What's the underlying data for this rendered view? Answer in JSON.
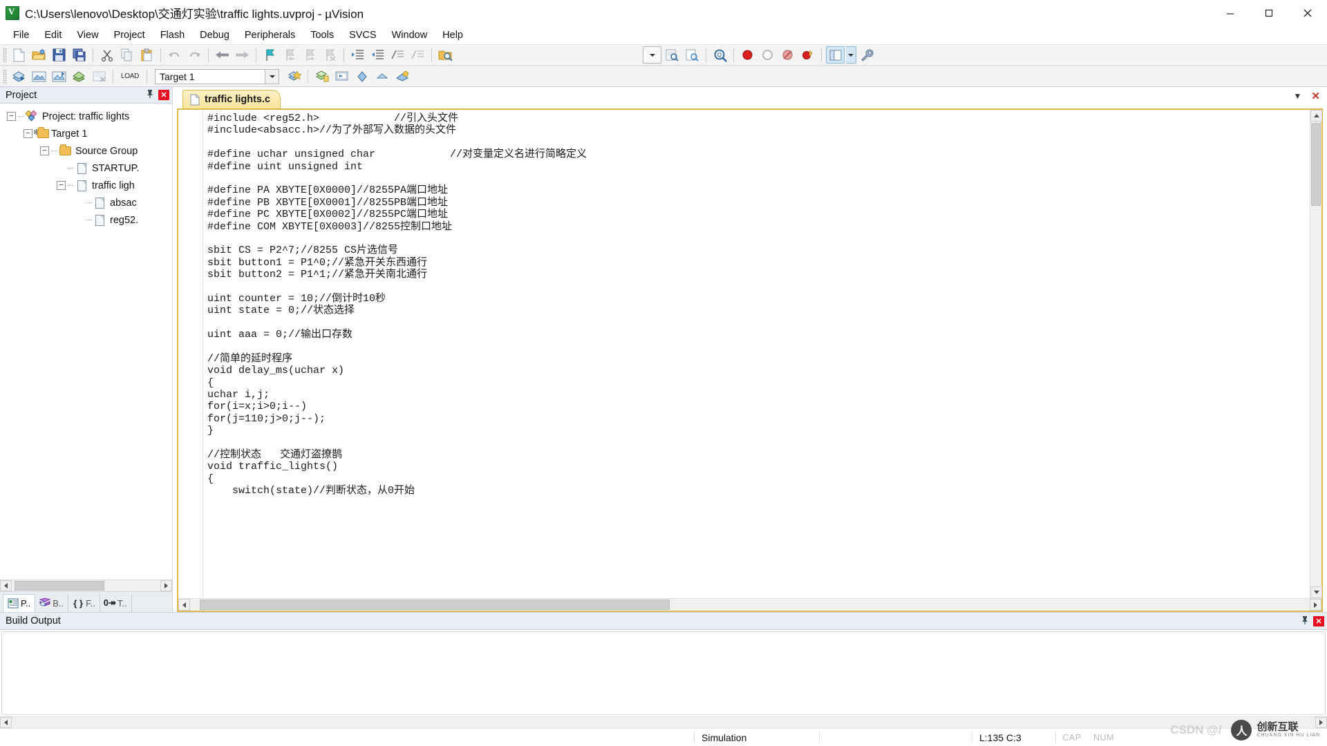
{
  "window": {
    "title": "C:\\Users\\lenovo\\Desktop\\交通灯实验\\traffic lights.uvproj - µVision",
    "minimize": "—",
    "maximize": "❐",
    "close": "✕"
  },
  "menu": {
    "items": [
      {
        "label": "File"
      },
      {
        "label": "Edit"
      },
      {
        "label": "View"
      },
      {
        "label": "Project"
      },
      {
        "label": "Flash"
      },
      {
        "label": "Debug"
      },
      {
        "label": "Peripherals"
      },
      {
        "label": "Tools"
      },
      {
        "label": "SVCS"
      },
      {
        "label": "Window"
      },
      {
        "label": "Help"
      }
    ]
  },
  "toolbar_main": {
    "buttons": [
      {
        "name": "new-file",
        "icon": "new-file-icon"
      },
      {
        "name": "open-file",
        "icon": "open-folder-icon"
      },
      {
        "name": "save",
        "icon": "save-disk-icon"
      },
      {
        "name": "save-all",
        "icon": "save-all-icon"
      },
      {
        "name": "cut",
        "icon": "scissors-icon"
      },
      {
        "name": "copy",
        "icon": "copy-icon"
      },
      {
        "name": "paste",
        "icon": "paste-icon"
      },
      {
        "name": "undo",
        "icon": "undo-arrow-icon"
      },
      {
        "name": "redo",
        "icon": "redo-arrow-icon"
      },
      {
        "name": "navigate-back",
        "icon": "arrow-left-icon"
      },
      {
        "name": "navigate-forward",
        "icon": "arrow-right-icon"
      },
      {
        "name": "insert-bookmark",
        "icon": "bookmark-flag-icon"
      },
      {
        "name": "previous-bookmark",
        "icon": "bookmark-prev-icon"
      },
      {
        "name": "next-bookmark",
        "icon": "bookmark-next-icon"
      },
      {
        "name": "clear-bookmarks",
        "icon": "bookmark-clear-icon"
      },
      {
        "name": "indent-right",
        "icon": "indent-right-icon"
      },
      {
        "name": "indent-left",
        "icon": "indent-left-icon"
      },
      {
        "name": "comment-block",
        "icon": "comment-icon"
      },
      {
        "name": "uncomment-block",
        "icon": "uncomment-icon"
      },
      {
        "name": "find-in-files",
        "icon": "find-files-icon"
      },
      {
        "name": "find-combo-drop",
        "icon": "chevron-down-icon"
      },
      {
        "name": "find",
        "icon": "find-icon"
      },
      {
        "name": "incremental-find",
        "icon": "incremental-find-icon"
      },
      {
        "name": "magnify",
        "icon": "magnifier-icon"
      },
      {
        "name": "insert-breakpoint",
        "icon": "breakpoint-red-icon"
      },
      {
        "name": "kill-breakpoint",
        "icon": "breakpoint-empty-icon"
      },
      {
        "name": "disable-breakpoint",
        "icon": "breakpoint-disable-icon"
      },
      {
        "name": "kill-all-breakpoints",
        "icon": "breakpoint-killall-icon"
      },
      {
        "name": "window-layout",
        "icon": "window-layout-icon"
      },
      {
        "name": "window-layout-drop",
        "icon": "chevron-down-icon"
      },
      {
        "name": "configuration",
        "icon": "wrench-icon"
      }
    ]
  },
  "toolbar_build": {
    "buttons": [
      {
        "name": "translate-file",
        "icon": "translate-icon"
      },
      {
        "name": "build-target",
        "icon": "build-icon"
      },
      {
        "name": "rebuild-all",
        "icon": "rebuild-icon"
      },
      {
        "name": "batch-build",
        "icon": "batch-build-icon"
      },
      {
        "name": "stop-build",
        "icon": "stop-build-icon"
      },
      {
        "name": "download",
        "icon": "load-icon",
        "label": "LOAD"
      },
      {
        "name": "manage-project-items",
        "icon": "manage-items-icon"
      },
      {
        "name": "options-for-target",
        "icon": "options-target-icon"
      },
      {
        "name": "start-stop-debug",
        "icon": "debug-icon"
      },
      {
        "name": "source-browse",
        "icon": "source-browse-icon"
      },
      {
        "name": "bookmark-set",
        "icon": "diamond-icon"
      },
      {
        "name": "insert-bookmark2",
        "icon": "chevron-icon"
      },
      {
        "name": "manage-run-time",
        "icon": "runtime-icon"
      }
    ],
    "target_selected": "Target 1",
    "target_placeholder": "Target 1"
  },
  "project_panel": {
    "caption": "Project",
    "pin_icon": "pin-icon",
    "close_icon": "close-icon",
    "tree": [
      {
        "label": "Project: traffic lights",
        "depth": 0,
        "expander": "−",
        "icon": "project-icon"
      },
      {
        "label": "Target 1",
        "depth": 1,
        "expander": "−",
        "icon": "target-folder-icon"
      },
      {
        "label": "Source Group",
        "depth": 2,
        "expander": "−",
        "icon": "folder-icon"
      },
      {
        "label": "STARTUP.",
        "depth": 3,
        "expander": "",
        "icon": "file-icon"
      },
      {
        "label": "traffic ligh",
        "depth": 3,
        "expander": "−",
        "icon": "file-icon"
      },
      {
        "label": "absac",
        "depth": 4,
        "expander": "",
        "icon": "file-icon"
      },
      {
        "label": "reg52.",
        "depth": 4,
        "expander": "",
        "icon": "file-icon"
      }
    ],
    "tabs": [
      {
        "label": "P..",
        "icon": "project-tab-icon",
        "active": true
      },
      {
        "label": "B..",
        "icon": "books-tab-icon",
        "active": false
      },
      {
        "label": "F..",
        "icon": "functions-tab-icon",
        "active": false
      },
      {
        "label": "T..",
        "icon": "templates-tab-icon",
        "active": false
      }
    ]
  },
  "editor": {
    "tab": {
      "label": "traffic lights.c",
      "icon": "document-icon"
    },
    "tab_controls": {
      "dropdown": "▼",
      "close": "✕"
    },
    "code_lines": [
      "#include <reg52.h>            //引入头文件",
      "#include<absacc.h>//为了外部写入数据的头文件",
      "",
      "#define uchar unsigned char            //对变量定义名进行简略定义",
      "#define uint unsigned int",
      "",
      "#define PA XBYTE[0X0000]//8255PA端口地址",
      "#define PB XBYTE[0X0001]//8255PB端口地址",
      "#define PC XBYTE[0X0002]//8255PC端口地址",
      "#define COM XBYTE[0X0003]//8255控制口地址",
      "",
      "sbit CS = P2^7;//8255 CS片选信号",
      "sbit button1 = P1^0;//紧急开关东西通行",
      "sbit button2 = P1^1;//紧急开关南北通行",
      "",
      "uint counter = 10;//倒计时10秒",
      "uint state = 0;//状态选择",
      "",
      "uint aaa = 0;//输出口存数",
      "",
      "//简单的延时程序",
      "void delay_ms(uchar x)",
      "{",
      "uchar i,j;",
      "for(i=x;i>0;i--)",
      "for(j=110;j>0;j--);",
      "}",
      "",
      "//控制状态   交通灯盗撩鹊",
      "void traffic_lights()",
      "{",
      "    switch(state)//判断状态，从0开始"
    ]
  },
  "build_output": {
    "caption": "Build Output",
    "pin_icon": "pin-icon",
    "close_icon": "close-icon",
    "content": ""
  },
  "statusbar": {
    "simulation": "Simulation",
    "cursor_position": "L:135 C:3",
    "caps": "CAP",
    "num": "NUM"
  },
  "watermark": {
    "csdn": "CSDN @/",
    "logo_letter": "人",
    "brand_cn": "创新互联",
    "brand_py": "CHUANG XIN HU LIAN"
  },
  "colors": {
    "tab_accent": "#e3b84b",
    "panel_caption_bg": "#e8eef4",
    "toolbar_bg": "#f4f4f4",
    "close_red": "#e81123"
  }
}
